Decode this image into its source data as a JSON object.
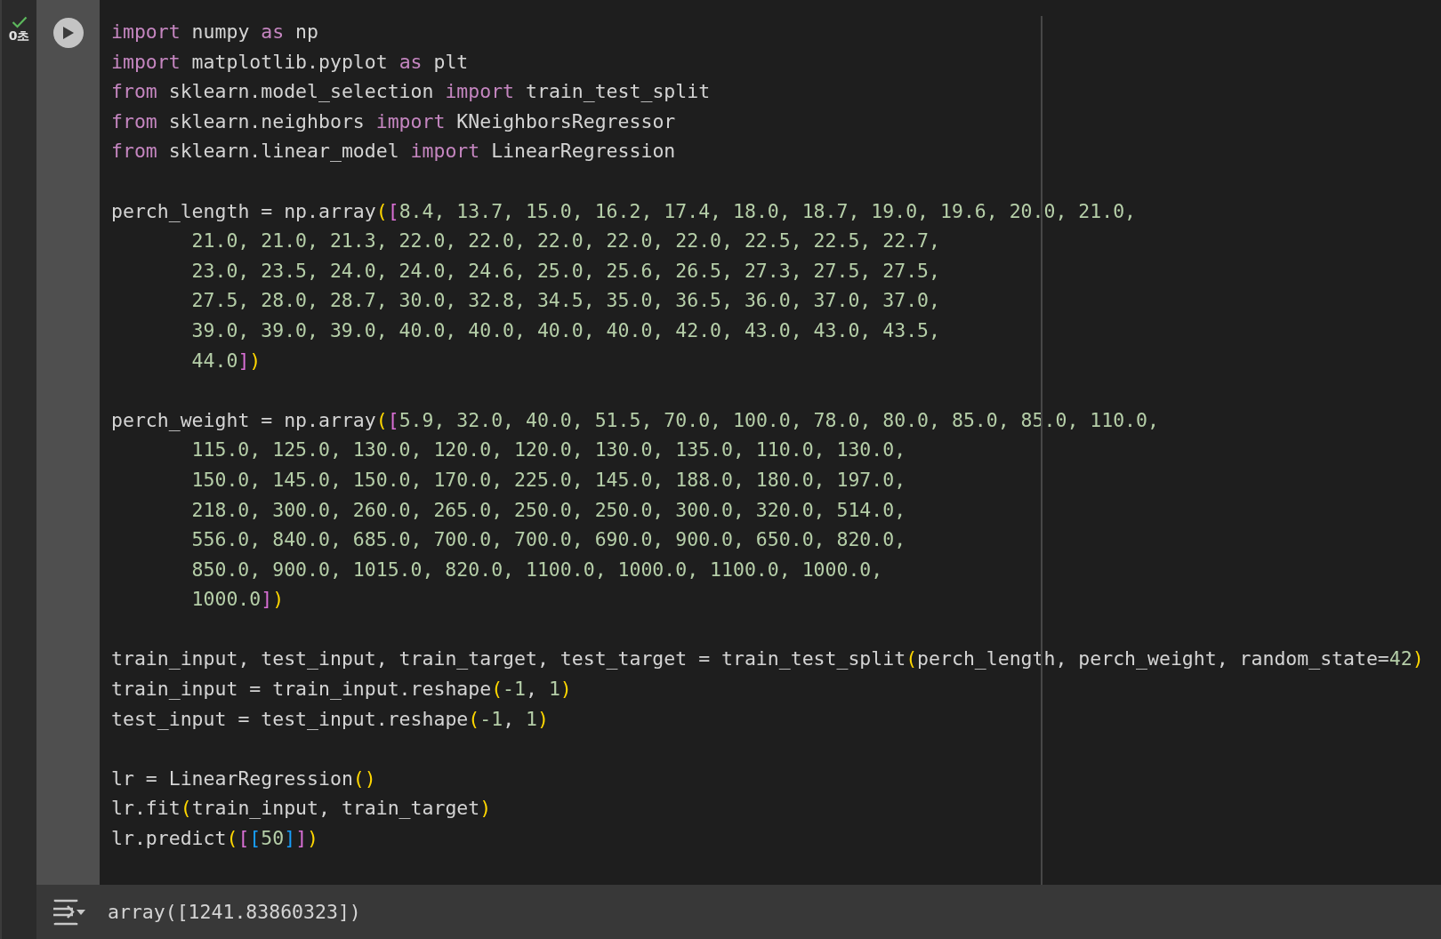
{
  "cell": {
    "completed": true,
    "time": "0초",
    "code_lines": [
      {
        "kind": "code",
        "segments": [
          {
            "kind": "keyword",
            "text": "import"
          },
          {
            "kind": "plain",
            "text": " numpy "
          },
          {
            "kind": "keyword",
            "text": "as"
          },
          {
            "kind": "plain",
            "text": " np"
          }
        ]
      },
      {
        "kind": "code",
        "segments": [
          {
            "kind": "keyword",
            "text": "import"
          },
          {
            "kind": "plain",
            "text": " matplotlib.pyplot "
          },
          {
            "kind": "keyword",
            "text": "as"
          },
          {
            "kind": "plain",
            "text": " plt"
          }
        ]
      },
      {
        "kind": "code",
        "segments": [
          {
            "kind": "keyword",
            "text": "from"
          },
          {
            "kind": "plain",
            "text": " sklearn.model_selection "
          },
          {
            "kind": "keyword",
            "text": "import"
          },
          {
            "kind": "plain",
            "text": " train_test_split"
          }
        ]
      },
      {
        "kind": "code",
        "segments": [
          {
            "kind": "keyword",
            "text": "from"
          },
          {
            "kind": "plain",
            "text": " sklearn.neighbors "
          },
          {
            "kind": "keyword",
            "text": "import"
          },
          {
            "kind": "plain",
            "text": " KNeighborsRegressor"
          }
        ]
      },
      {
        "kind": "code",
        "segments": [
          {
            "kind": "keyword",
            "text": "from"
          },
          {
            "kind": "plain",
            "text": " sklearn.linear_model "
          },
          {
            "kind": "keyword",
            "text": "import"
          },
          {
            "kind": "plain",
            "text": " LinearRegression"
          }
        ]
      },
      {
        "kind": "blank"
      },
      {
        "kind": "code",
        "segments": [
          {
            "kind": "plain",
            "text": "perch_length = np.array"
          },
          {
            "kind": "paren",
            "text": "("
          },
          {
            "kind": "bracket",
            "text": "["
          },
          {
            "kind": "number",
            "text": "8.4, 13.7, 15.0, 16.2, 17.4, 18.0, 18.7, 19.0, 19.6, 20.0, 21.0,"
          }
        ]
      },
      {
        "kind": "continuation",
        "segments": [
          {
            "kind": "number",
            "text": "21.0, 21.0, 21.3, 22.0, 22.0, 22.0, 22.0, 22.0, 22.5, 22.5, 22.7,"
          }
        ]
      },
      {
        "kind": "continuation",
        "segments": [
          {
            "kind": "number",
            "text": "23.0, 23.5, 24.0, 24.0, 24.6, 25.0, 25.6, 26.5, 27.3, 27.5, 27.5,"
          }
        ]
      },
      {
        "kind": "continuation",
        "segments": [
          {
            "kind": "number",
            "text": "27.5, 28.0, 28.7, 30.0, 32.8, 34.5, 35.0, 36.5, 36.0, 37.0, 37.0,"
          }
        ]
      },
      {
        "kind": "continuation",
        "segments": [
          {
            "kind": "number",
            "text": "39.0, 39.0, 39.0, 40.0, 40.0, 40.0, 40.0, 42.0, 43.0, 43.0, 43.5,"
          }
        ]
      },
      {
        "kind": "continuation",
        "segments": [
          {
            "kind": "number",
            "text": "44.0"
          },
          {
            "kind": "bracket",
            "text": "]"
          },
          {
            "kind": "paren",
            "text": ")"
          }
        ]
      },
      {
        "kind": "blank"
      },
      {
        "kind": "code",
        "segments": [
          {
            "kind": "plain",
            "text": "perch_weight = np.array"
          },
          {
            "kind": "paren",
            "text": "("
          },
          {
            "kind": "bracket",
            "text": "["
          },
          {
            "kind": "number",
            "text": "5.9, 32.0, 40.0, 51.5, 70.0, 100.0, 78.0, 80.0, 85.0, 85.0, 110.0,"
          }
        ]
      },
      {
        "kind": "continuation",
        "segments": [
          {
            "kind": "number",
            "text": "115.0, 125.0, 130.0, 120.0, 120.0, 130.0, 135.0, 110.0, 130.0,"
          }
        ]
      },
      {
        "kind": "continuation",
        "segments": [
          {
            "kind": "number",
            "text": "150.0, 145.0, 150.0, 170.0, 225.0, 145.0, 188.0, 180.0, 197.0,"
          }
        ]
      },
      {
        "kind": "continuation",
        "segments": [
          {
            "kind": "number",
            "text": "218.0, 300.0, 260.0, 265.0, 250.0, 250.0, 300.0, 320.0, 514.0,"
          }
        ]
      },
      {
        "kind": "continuation",
        "segments": [
          {
            "kind": "number",
            "text": "556.0, 840.0, 685.0, 700.0, 700.0, 690.0, 900.0, 650.0, 820.0,"
          }
        ]
      },
      {
        "kind": "continuation",
        "segments": [
          {
            "kind": "number",
            "text": "850.0, 900.0, 1015.0, 820.0, 1100.0, 1000.0, 1100.0, 1000.0,"
          }
        ]
      },
      {
        "kind": "continuation",
        "segments": [
          {
            "kind": "number",
            "text": "1000.0"
          },
          {
            "kind": "bracket",
            "text": "]"
          },
          {
            "kind": "paren",
            "text": ")"
          }
        ]
      },
      {
        "kind": "blank"
      },
      {
        "kind": "code",
        "segments": [
          {
            "kind": "plain",
            "text": "train_input, test_input, train_target, test_target = train_test_split"
          },
          {
            "kind": "paren",
            "text": "("
          },
          {
            "kind": "plain",
            "text": "perch_length, perch_weight, random_state="
          },
          {
            "kind": "number",
            "text": "42"
          },
          {
            "kind": "paren",
            "text": ")"
          }
        ]
      },
      {
        "kind": "code",
        "segments": [
          {
            "kind": "plain",
            "text": "train_input = train_input.reshape"
          },
          {
            "kind": "paren",
            "text": "("
          },
          {
            "kind": "number",
            "text": "-1"
          },
          {
            "kind": "plain",
            "text": ", "
          },
          {
            "kind": "number",
            "text": "1"
          },
          {
            "kind": "paren",
            "text": ")"
          }
        ]
      },
      {
        "kind": "code",
        "segments": [
          {
            "kind": "plain",
            "text": "test_input = test_input.reshape"
          },
          {
            "kind": "paren",
            "text": "("
          },
          {
            "kind": "number",
            "text": "-1"
          },
          {
            "kind": "plain",
            "text": ", "
          },
          {
            "kind": "number",
            "text": "1"
          },
          {
            "kind": "paren",
            "text": ")"
          }
        ]
      },
      {
        "kind": "blank"
      },
      {
        "kind": "code",
        "segments": [
          {
            "kind": "plain",
            "text": "lr = LinearRegression"
          },
          {
            "kind": "paren",
            "text": "()"
          }
        ]
      },
      {
        "kind": "code",
        "segments": [
          {
            "kind": "plain",
            "text": "lr.fit"
          },
          {
            "kind": "paren",
            "text": "("
          },
          {
            "kind": "plain",
            "text": "train_input, train_target"
          },
          {
            "kind": "paren",
            "text": ")"
          }
        ]
      },
      {
        "kind": "code",
        "segments": [
          {
            "kind": "plain",
            "text": "lr.predict"
          },
          {
            "kind": "paren",
            "text": "("
          },
          {
            "kind": "bracket",
            "text": "["
          },
          {
            "kind": "bracket2",
            "text": "["
          },
          {
            "kind": "number",
            "text": "50"
          },
          {
            "kind": "bracket2",
            "text": "]"
          },
          {
            "kind": "bracket",
            "text": "]"
          },
          {
            "kind": "paren",
            "text": ")"
          }
        ]
      }
    ],
    "output": {
      "text": "array([1241.83860323])"
    }
  }
}
